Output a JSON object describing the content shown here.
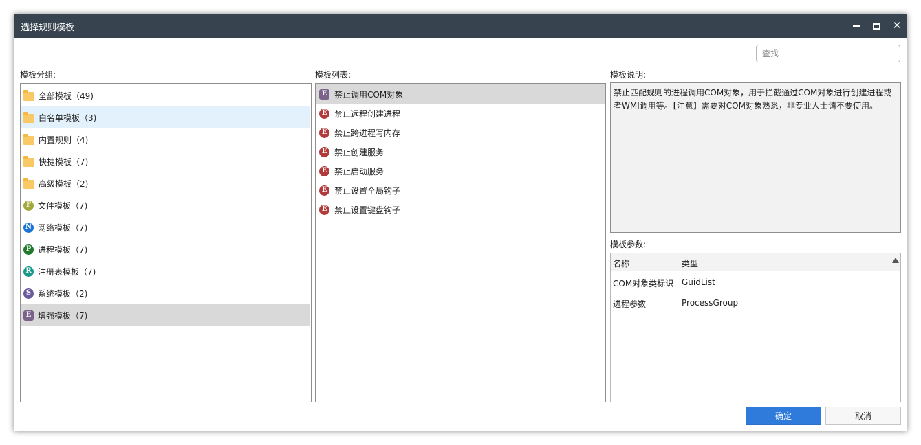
{
  "window": {
    "title": "选择规则模板"
  },
  "search": {
    "placeholder": "查找"
  },
  "groups": {
    "label": "模板分组:",
    "items": [
      {
        "text": "全部模板（49)",
        "icon": "folder-icon"
      },
      {
        "text": "白名单模板（3)",
        "icon": "folder-icon"
      },
      {
        "text": "内置规则（4)",
        "icon": "folder-icon"
      },
      {
        "text": "快捷模板（7)",
        "icon": "folder-icon"
      },
      {
        "text": "高级模板（2)",
        "icon": "folder-icon"
      },
      {
        "text": "文件模板（7)",
        "icon": "file-badge-icon",
        "letter": "F",
        "color": "#a3a83a"
      },
      {
        "text": "网络模板（7)",
        "icon": "network-badge-icon",
        "letter": "N",
        "color": "#1a74d4"
      },
      {
        "text": "进程模板（7)",
        "icon": "process-badge-icon",
        "letter": "P",
        "color": "#1f7a2b"
      },
      {
        "text": "注册表模板（7)",
        "icon": "registry-badge-icon",
        "letter": "R",
        "color": "#19998c"
      },
      {
        "text": "系统模板（2)",
        "icon": "system-badge-icon",
        "letter": "S",
        "color": "#6a5ba0"
      },
      {
        "text": "增强模板（7)",
        "icon": "enhanced-badge-icon",
        "letter": "E",
        "color": "#7a628a"
      }
    ]
  },
  "templates": {
    "label": "模板列表:",
    "items": [
      {
        "text": "禁止调用COM对象",
        "letter": "E",
        "color": "#7a628a"
      },
      {
        "text": "禁止远程创建进程",
        "letter": "E",
        "color": "#b23a3a"
      },
      {
        "text": "禁止跨进程写内存",
        "letter": "E",
        "color": "#b23a3a"
      },
      {
        "text": "禁止创建服务",
        "letter": "E",
        "color": "#b23a3a"
      },
      {
        "text": "禁止启动服务",
        "letter": "E",
        "color": "#b23a3a"
      },
      {
        "text": "禁止设置全局钩子",
        "letter": "E",
        "color": "#b23a3a"
      },
      {
        "text": "禁止设置键盘钩子",
        "letter": "E",
        "color": "#b23a3a"
      }
    ]
  },
  "description": {
    "label": "模板说明:",
    "text": "禁止匹配规则的进程调用COM对象，用于拦截通过COM对象进行创建进程或者WMI调用等。【注意】需要对COM对象熟悉，非专业人士请不要使用。"
  },
  "params": {
    "label": "模板参数:",
    "columns": [
      "名称",
      "类型"
    ],
    "rows": [
      {
        "name": "COM对象类标识",
        "type": "GuidList"
      },
      {
        "name": "进程参数",
        "type": "ProcessGroup"
      }
    ]
  },
  "buttons": {
    "ok": "确定",
    "cancel": "取消"
  },
  "colors": {
    "titlebar": "#37444f",
    "primary": "#2f7bdc",
    "selection": "#d9d9d9",
    "hover": "#e3f1fc"
  }
}
